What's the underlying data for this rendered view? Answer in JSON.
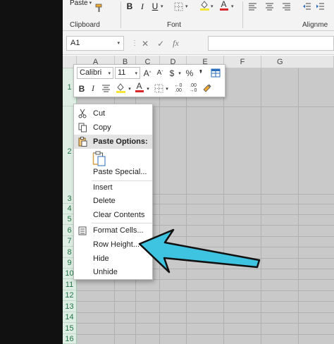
{
  "ribbon": {
    "paste_label": "Paste",
    "groups": {
      "clipboard": "Clipboard",
      "font": "Font",
      "alignment": "Alignme"
    }
  },
  "formula_bar": {
    "name_box": "A1",
    "cancel_symbol": "✕",
    "enter_symbol": "✓",
    "fx_symbol": "fx",
    "value": ""
  },
  "columns": [
    "A",
    "B",
    "C",
    "D",
    "E",
    "F",
    "G"
  ],
  "rows": [
    "1",
    "2",
    "3",
    "4",
    "5",
    "6",
    "7",
    "8",
    "9",
    "10",
    "11",
    "12",
    "13",
    "14",
    "15",
    "16"
  ],
  "mini_toolbar": {
    "font": "Calibri",
    "size": "11",
    "grow": "A",
    "shrink": "A",
    "currency": "$",
    "percent": "%",
    "comma": "❜",
    "bold": "B",
    "italic": "I",
    "fill_letter": "A",
    "font_color_letter": "A",
    "dec_increase": "←0\n.00",
    "dec_decrease": ".00\n→0"
  },
  "context_menu": {
    "cut": "Cut",
    "copy": "Copy",
    "paste_options": "Paste Options:",
    "paste_special": "Paste Special...",
    "insert": "Insert",
    "delete": "Delete",
    "clear_contents": "Clear Contents",
    "format_cells": "Format Cells...",
    "row_height": "Row Height...",
    "hide": "Hide",
    "unhide": "Unhide"
  },
  "colors": {
    "arrow": "#3ec3e0",
    "row_header_selected": "#dfeee4",
    "excel_green": "#217346",
    "font_color_red": "#d9262b"
  }
}
